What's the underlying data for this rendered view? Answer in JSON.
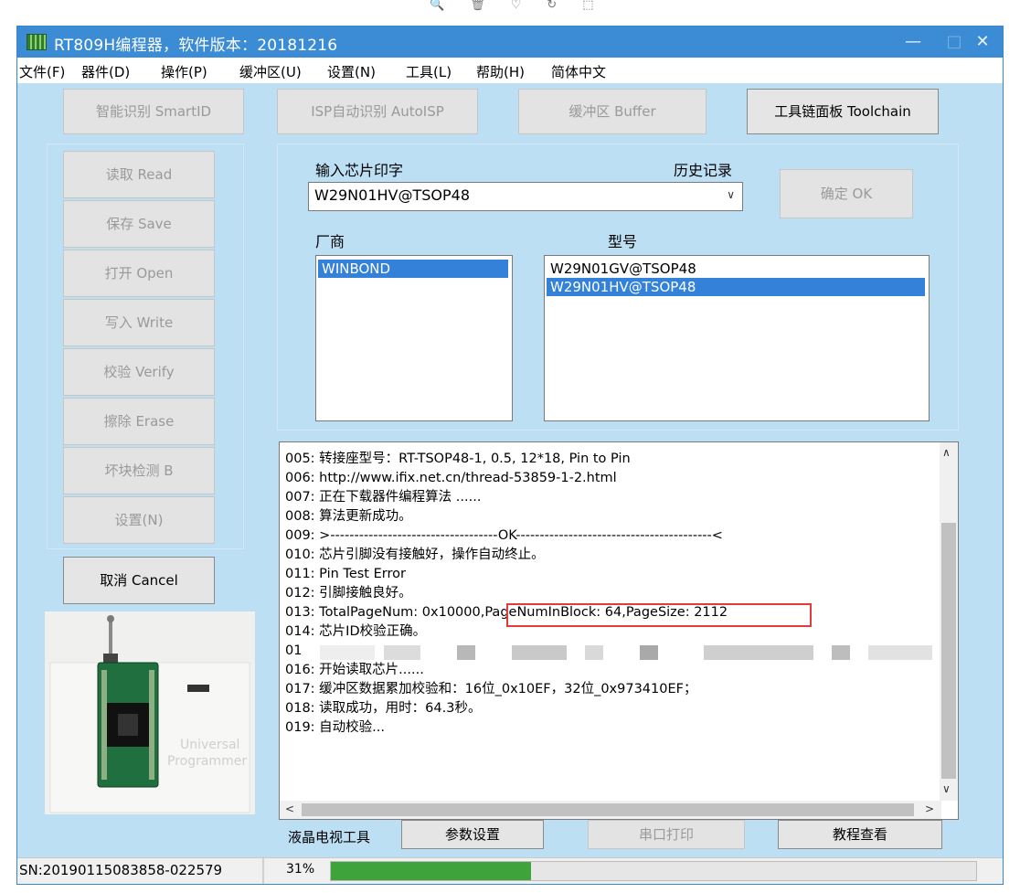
{
  "window": {
    "title": "RT809H编程器，软件版本：20181216",
    "controls": {
      "minimize": "—",
      "maximize": "□",
      "close": "✕"
    }
  },
  "float_toolbar": [
    "🔍",
    "🗑",
    "♡",
    "↻",
    "⬚"
  ],
  "menu": [
    "文件(F)",
    "器件(D)",
    "操作(P)",
    "缓冲区(U)",
    "设置(N)",
    "工具(L)",
    "帮助(H)",
    "简体中文"
  ],
  "top_buttons": {
    "smartid": "智能识别 SmartID",
    "autoisp": "ISP自动识别 AutoISP",
    "buffer": "缓冲区 Buffer",
    "toolchain": "工具链面板 Toolchain"
  },
  "side_buttons": [
    "读取 Read",
    "保存 Save",
    "打开 Open",
    "写入 Write",
    "校验 Verify",
    "擦除 Erase",
    "坏块检测 B",
    "设置(N)"
  ],
  "cancel_button": "取消 Cancel",
  "chip_panel": {
    "input_label": "输入芯片印字",
    "history_label": "历史记录",
    "chip_value": "W29N01HV@TSOP48",
    "ok_button": "确定 OK",
    "vendor_label": "厂商",
    "model_label": "型号",
    "vendors": [
      {
        "name": "WINBOND",
        "selected": true
      }
    ],
    "models": [
      {
        "name": "W29N01GV@TSOP48",
        "selected": false
      },
      {
        "name": "W29N01HV@TSOP48",
        "selected": true
      }
    ]
  },
  "log_lines": [
    "005: 转接座型号：RT-TSOP48-1, 0.5, 12*18, Pin to Pin",
    "006: http://www.ifix.net.cn/thread-53859-1-2.html",
    "007: 正在下载器件编程算法 ......",
    "008: 算法更新成功。",
    "009: >-----------------------------------OK-----------------------------------------<",
    "010: 芯片引脚没有接触好，操作自动终止。",
    "011: Pin Test Error",
    "012: 引脚接触良好。",
    "013: TotalPageNum: 0x10000,PageNumInBlock: 64,PageSize: 2112",
    "014: 芯片ID校验正确。",
    "01",
    "016: 开始读取芯片......",
    "017: 缓冲区数据累加校验和：16位_0x10EF，32位_0x973410EF；",
    "018: 读取成功，用时：64.3秒。",
    "019: 自动校验..."
  ],
  "bottom_buttons": {
    "lcd_tool": "液晶电视工具",
    "params": "参数设置",
    "serial_print": "串口打印",
    "tutorial": "教程查看"
  },
  "device_image_text": [
    "Universal",
    "Programmer"
  ],
  "status": {
    "sn": "SN:20190115083858-022579",
    "progress_label": "31%",
    "progress_fraction": 0.31
  },
  "colors": {
    "window_bg": "#bcdff3",
    "titlebar": "#3b8cd4",
    "selection": "#3381d8",
    "progress": "#3da33a",
    "highlight_box": "#e23b3b"
  }
}
